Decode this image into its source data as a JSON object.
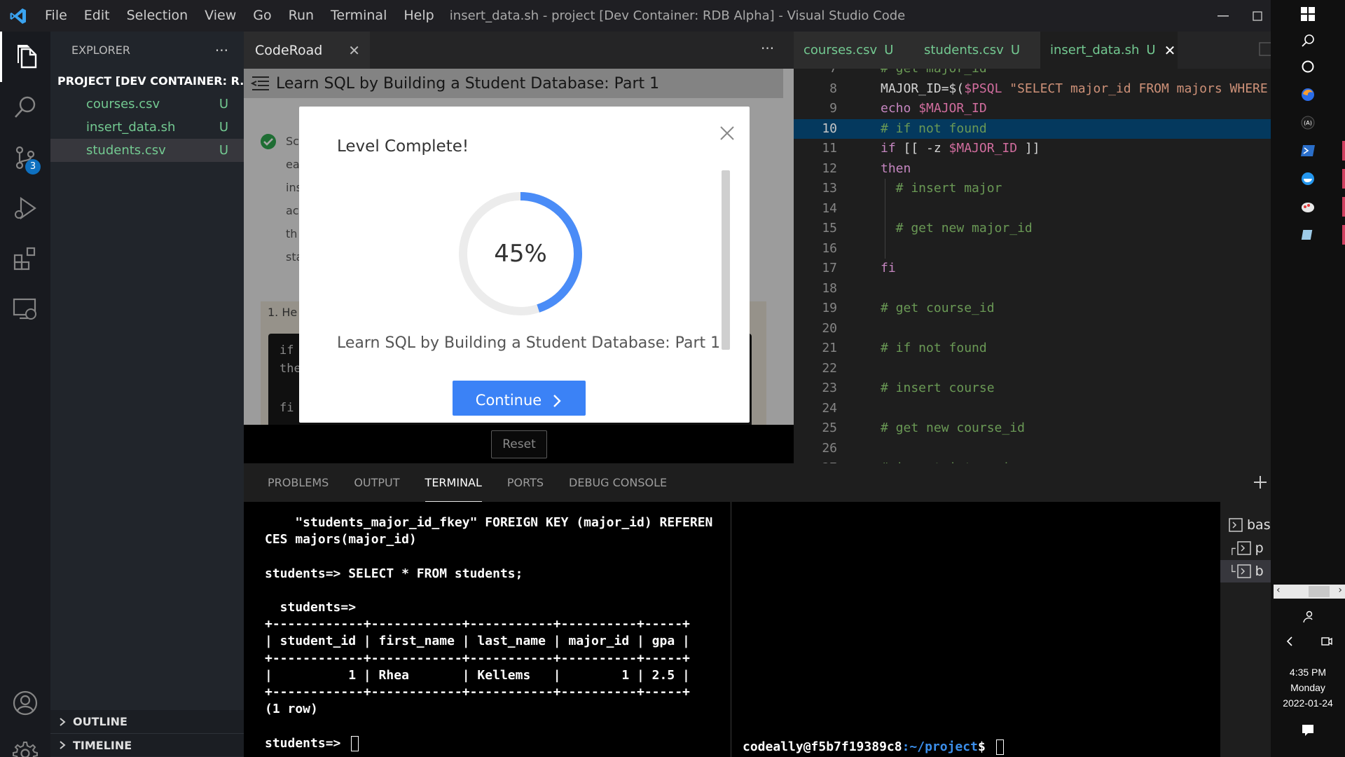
{
  "window": {
    "title": "insert_data.sh - project [Dev Container: RDB Alpha] - Visual Studio Code",
    "menu": [
      "File",
      "Edit",
      "Selection",
      "View",
      "Go",
      "Run",
      "Terminal",
      "Help"
    ]
  },
  "activitybar": {
    "scm_badge": "3"
  },
  "explorer": {
    "header": "EXPLORER",
    "more": "···",
    "folder": "PROJECT [DEV CONTAINER: R...",
    "files": [
      {
        "name": "courses.csv",
        "status": "U"
      },
      {
        "name": "insert_data.sh",
        "status": "U"
      },
      {
        "name": "students.csv",
        "status": "U"
      }
    ],
    "outline": "OUTLINE",
    "timeline": "TIMELINE"
  },
  "coderoad": {
    "tab_label": "CodeRoad",
    "more": "···",
    "header_title": "Learn SQL by Building a Student Database: Part 1",
    "bg_lines": [
      "Sc",
      "ea",
      "ins",
      "ac",
      "th",
      "sta"
    ],
    "step_label": "1. He",
    "code_frag": [
      "if",
      "the",
      "fi"
    ],
    "reset_label": "Reset",
    "modal": {
      "title": "Level Complete!",
      "progress_text": "45%",
      "progress": 0.45,
      "subtitle": "Learn SQL by Building a Student Database: Part 1",
      "continue_label": "Continue"
    }
  },
  "editor": {
    "tabs": [
      {
        "name": "courses.csv",
        "status": "U"
      },
      {
        "name": "students.csv",
        "status": "U"
      },
      {
        "name": "insert_data.sh",
        "status": "U"
      }
    ],
    "lines": [
      {
        "n": "7",
        "text": "# get major_id"
      },
      {
        "n": "8",
        "text": "MAJOR_ID=$($PSQL \"SELECT major_id FROM majors WHERE"
      },
      {
        "n": "9",
        "text": "echo $MAJOR_ID"
      },
      {
        "n": "10",
        "text": "# if not found"
      },
      {
        "n": "11",
        "text": "if [[ -z $MAJOR_ID ]]"
      },
      {
        "n": "12",
        "text": "then"
      },
      {
        "n": "13",
        "text": "  # insert major"
      },
      {
        "n": "14",
        "text": ""
      },
      {
        "n": "15",
        "text": "  # get new major_id"
      },
      {
        "n": "16",
        "text": ""
      },
      {
        "n": "17",
        "text": "fi"
      },
      {
        "n": "18",
        "text": ""
      },
      {
        "n": "19",
        "text": "# get course_id"
      },
      {
        "n": "20",
        "text": ""
      },
      {
        "n": "21",
        "text": "# if not found"
      },
      {
        "n": "22",
        "text": ""
      },
      {
        "n": "23",
        "text": "# insert course"
      },
      {
        "n": "24",
        "text": ""
      },
      {
        "n": "25",
        "text": "# get new course_id"
      },
      {
        "n": "26",
        "text": ""
      },
      {
        "n": "27",
        "text": "# insert into majors_courses"
      }
    ]
  },
  "panel": {
    "tabs": [
      "PROBLEMS",
      "OUTPUT",
      "TERMINAL",
      "PORTS",
      "DEBUG CONSOLE"
    ],
    "active_tab": "TERMINAL",
    "terminal_left": [
      "    \"students_major_id_fkey\" FOREIGN KEY (major_id) REFEREN",
      "CES majors(major_id)",
      "",
      "students=> SELECT * FROM students;",
      "",
      "  students=>",
      "+------------+------------+-----------+----------+-----+",
      "| student_id | first_name | last_name | major_id | gpa |",
      "+------------+------------+-----------+----------+-----+",
      "|          1 | Rhea       | Kellems   |        1 | 2.5 |",
      "+------------+------------+-----------+----------+-----+",
      "(1 row)",
      "",
      "students=> "
    ],
    "terminal_right_prompt_user": "codeally@f5b7f19389c8",
    "terminal_right_prompt_path": ":~/project",
    "terminal_right_prompt_end": "$ ",
    "terminal_list": [
      "bas",
      "p",
      "b"
    ]
  },
  "taskbar": {
    "time": "4:35 PM",
    "day": "Monday",
    "date": "2022-01-24"
  },
  "colors": {
    "accent": "#3b82f6",
    "untracked": "#73c991",
    "badge": "#0e70c0"
  }
}
